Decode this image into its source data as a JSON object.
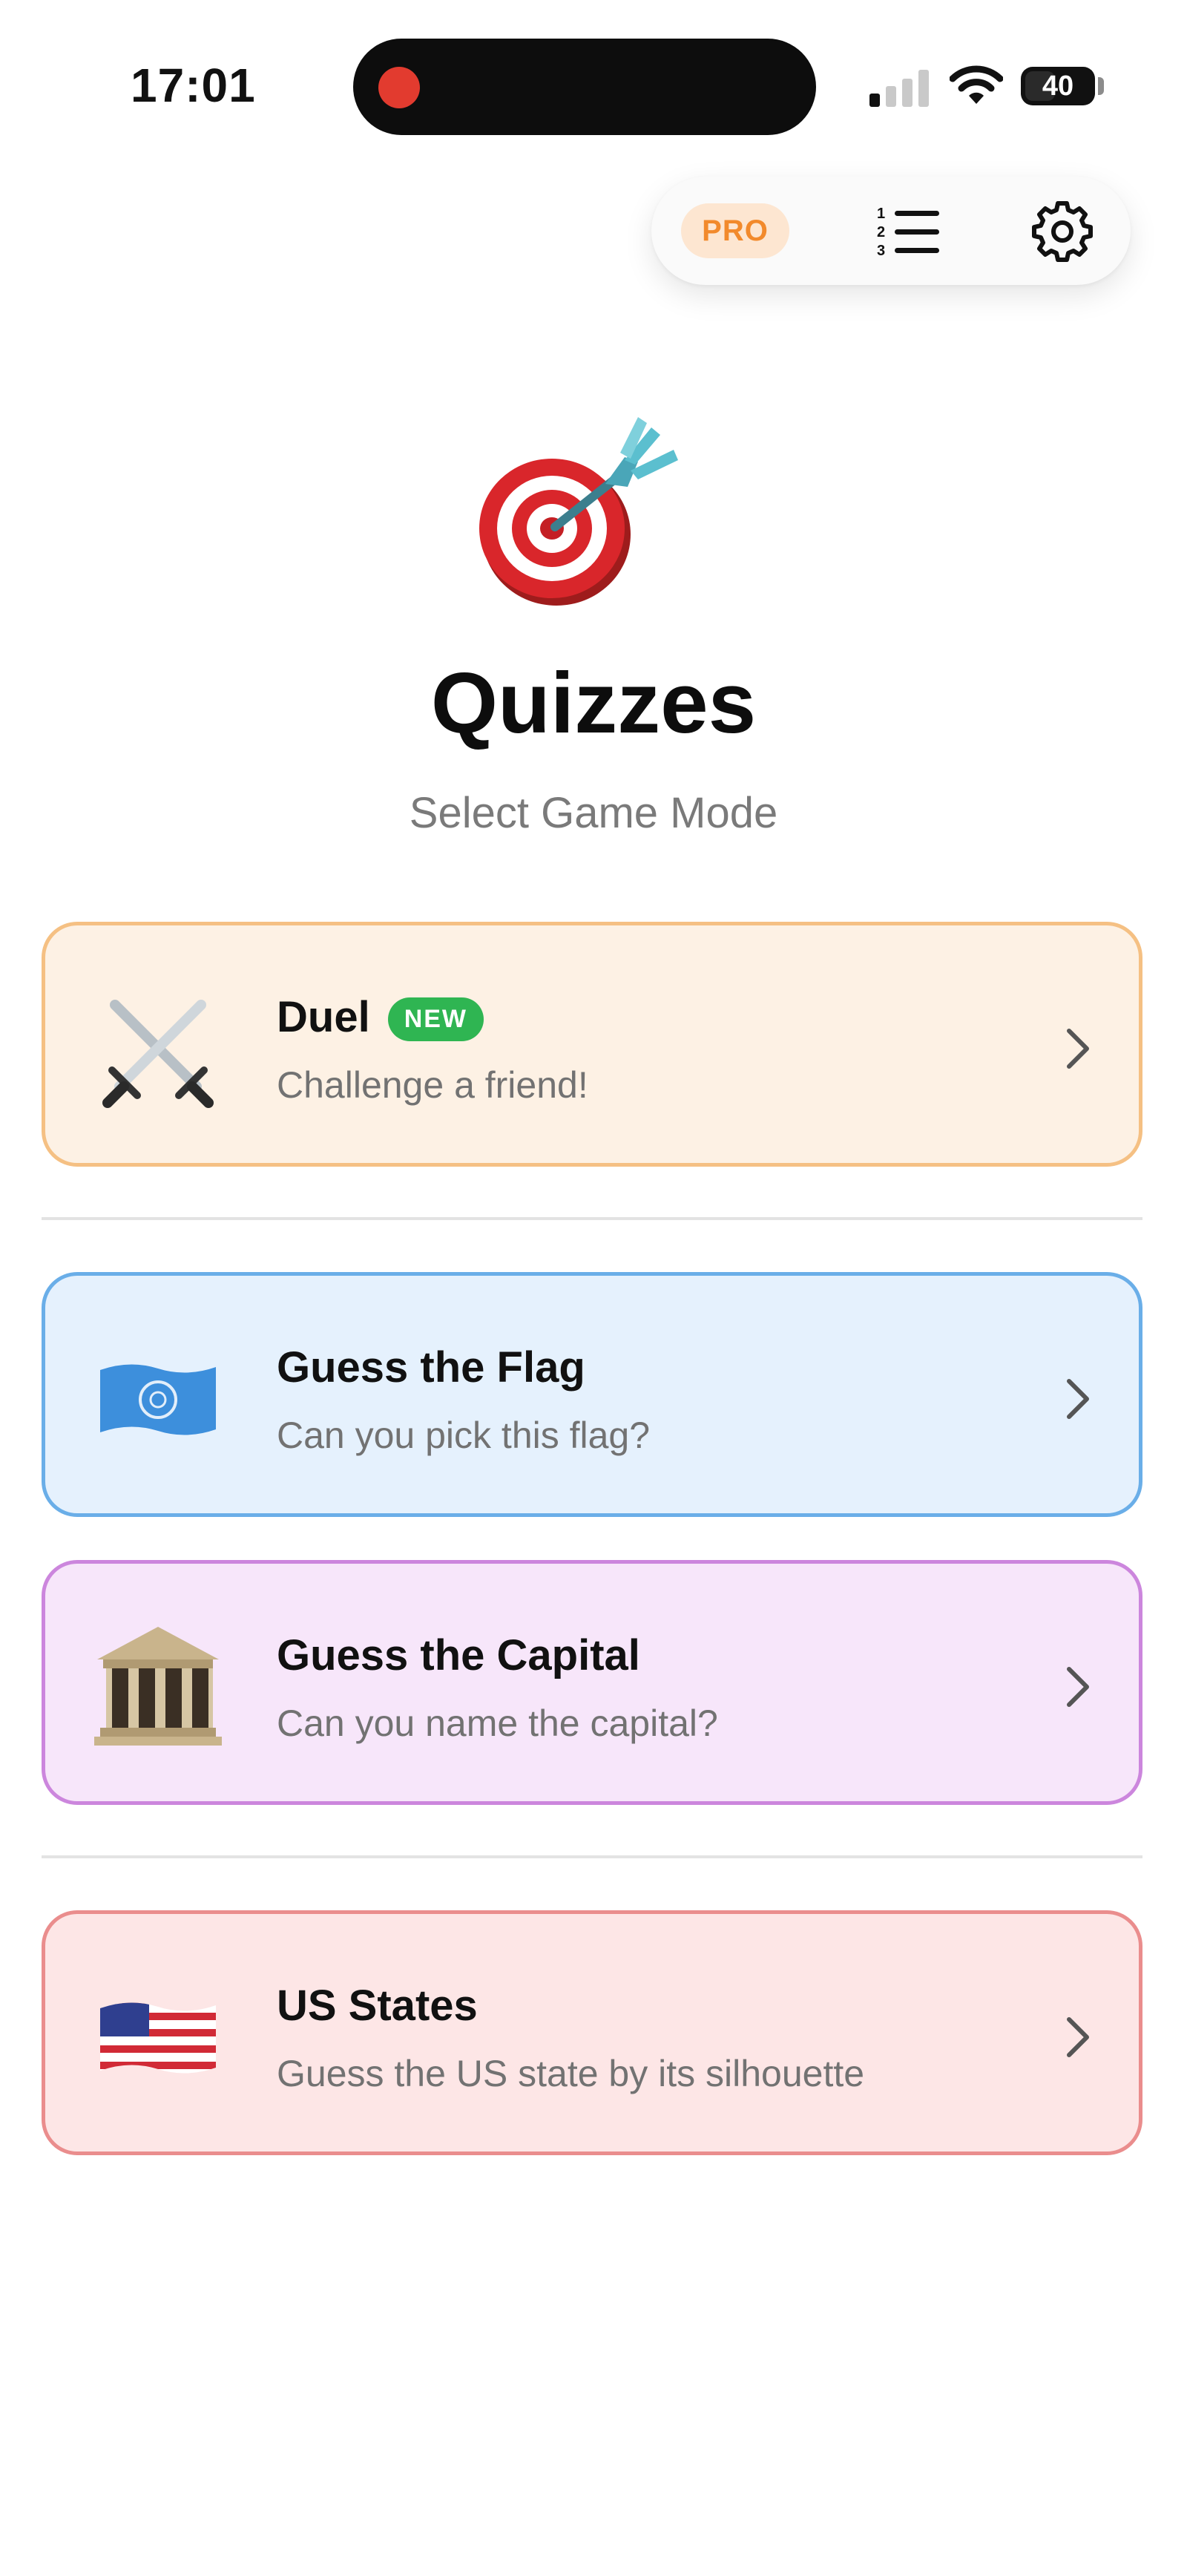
{
  "status_bar": {
    "time": "17:01",
    "battery": "40"
  },
  "toolbar": {
    "pro_label": "PRO",
    "leaderboard_icon": "numbered-list-icon",
    "settings_icon": "gear-icon"
  },
  "hero": {
    "emoji": "direct-hit-target-icon",
    "title": "Quizzes",
    "subtitle": "Select Game Mode"
  },
  "modes": [
    {
      "label": "Duel",
      "badge": "NEW",
      "description": "Challenge a friend!",
      "icon": "crossed-swords-icon",
      "accent": "#f5c083",
      "background": "#fdf1e4"
    },
    {
      "label": "Guess the Flag",
      "description": "Can you pick this flag?",
      "icon": "un-flag-icon",
      "accent": "#6aaee8",
      "background": "#e5f1fd"
    },
    {
      "label": "Guess the Capital",
      "description": "Can you name the capital?",
      "icon": "classical-building-icon",
      "accent": "#cc86dd",
      "background": "#f7e6fa"
    },
    {
      "label": "US States",
      "description": "Guess the US state by its silhouette",
      "icon": "us-flag-icon",
      "accent": "#ea8d8d",
      "background": "#fde6e6"
    }
  ],
  "colors": {
    "pro_accent": "#f28a2c",
    "new_badge": "#2fb552"
  }
}
